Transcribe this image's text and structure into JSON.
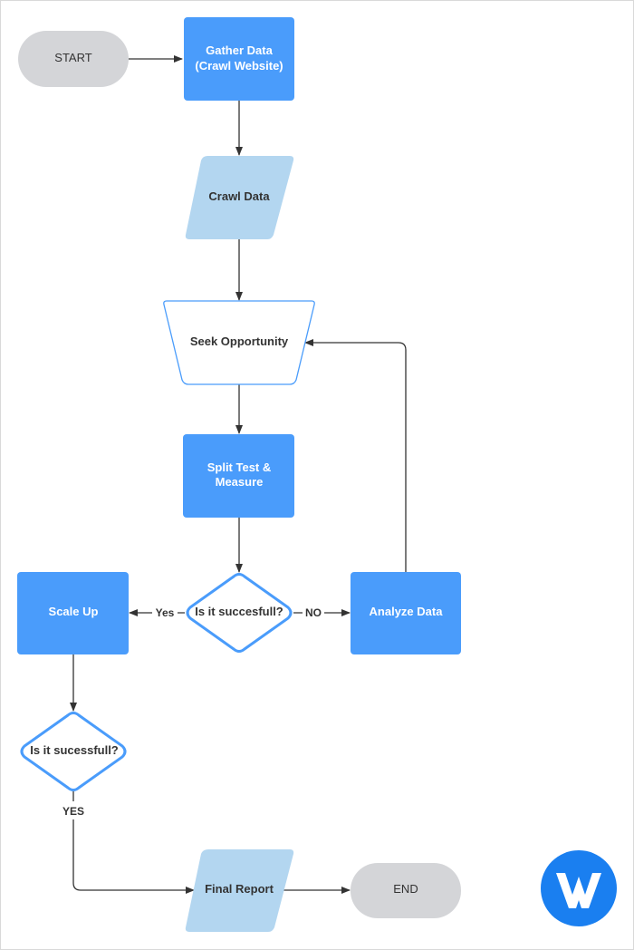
{
  "diagram": {
    "colors": {
      "process_fill": "#4a9cfb",
      "data_fill": "#b3d6f0",
      "terminal_fill": "#d4d5d8",
      "decision_stroke": "#4a9cfb",
      "connector": "#333333",
      "logo_fill": "#1a7ff0"
    },
    "nodes": {
      "start": {
        "label": "START",
        "type": "terminal"
      },
      "gather": {
        "label_line1": "Gather Data",
        "label_line2": "(Crawl Website)",
        "type": "process"
      },
      "crawl": {
        "label": "Crawl Data",
        "type": "data"
      },
      "seek": {
        "label": "Seek Opportunity",
        "type": "manual-operation"
      },
      "split": {
        "label_line1": "Split Test &",
        "label_line2": "Measure",
        "type": "process"
      },
      "decision1": {
        "label": "Is it succesfull?",
        "type": "decision"
      },
      "scale": {
        "label": "Scale Up",
        "type": "process"
      },
      "analyze": {
        "label": "Analyze Data",
        "type": "process"
      },
      "decision2": {
        "label": "Is it sucessfull?",
        "type": "decision"
      },
      "report": {
        "label": "Final Report",
        "type": "data"
      },
      "end": {
        "label": "END",
        "type": "terminal"
      }
    },
    "edges": {
      "start_gather": {
        "from": "start",
        "to": "gather",
        "label": ""
      },
      "gather_crawl": {
        "from": "gather",
        "to": "crawl",
        "label": ""
      },
      "crawl_seek": {
        "from": "crawl",
        "to": "seek",
        "label": ""
      },
      "seek_split": {
        "from": "seek",
        "to": "split",
        "label": ""
      },
      "split_decision1": {
        "from": "split",
        "to": "decision1",
        "label": ""
      },
      "decision1_scale": {
        "from": "decision1",
        "to": "scale",
        "label": "Yes"
      },
      "decision1_analyze": {
        "from": "decision1",
        "to": "analyze",
        "label": "NO"
      },
      "analyze_seek": {
        "from": "analyze",
        "to": "seek",
        "label": ""
      },
      "scale_decision2": {
        "from": "scale",
        "to": "decision2",
        "label": ""
      },
      "decision2_report": {
        "from": "decision2",
        "to": "report",
        "label": "YES"
      },
      "report_end": {
        "from": "report",
        "to": "end",
        "label": ""
      }
    }
  },
  "logo": {
    "letter": "W",
    "icon": "w-logo-icon"
  }
}
